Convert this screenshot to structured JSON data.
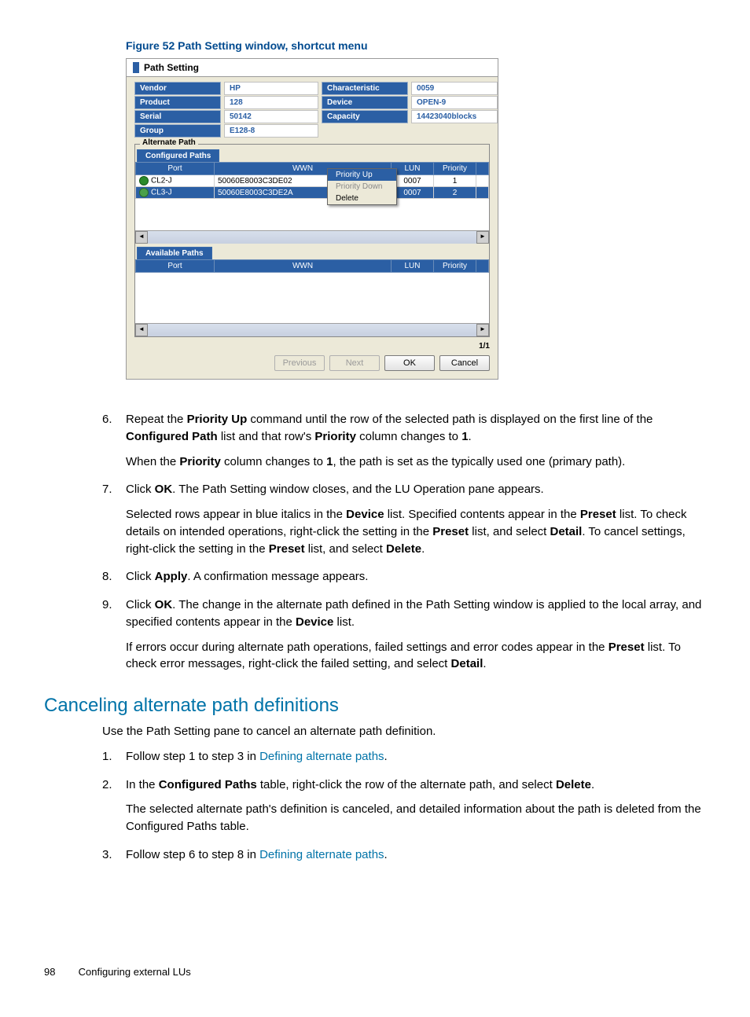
{
  "figure_caption": "Figure 52 Path Setting window, shortcut menu",
  "window": {
    "title": "Path Setting",
    "info": {
      "labels": {
        "vendor": "Vendor",
        "characteristic": "Characteristic",
        "product": "Product",
        "device": "Device",
        "serial": "Serial",
        "capacity": "Capacity",
        "group": "Group"
      },
      "values": {
        "vendor": "HP",
        "characteristic": "0059",
        "product": "128",
        "device": "OPEN-9",
        "serial": "50142",
        "capacity": "14423040blocks",
        "group": "E128-8"
      }
    },
    "alternate_path_label": "Alternate Path",
    "configured_tab": "Configured Paths",
    "available_tab": "Available Paths",
    "columns": {
      "port": "Port",
      "wwn": "WWN",
      "lun": "LUN",
      "priority": "Priority"
    },
    "configured_rows": [
      {
        "port": "CL2-J",
        "wwn": "50060E8003C3DE02",
        "lun": "0007",
        "priority": "1",
        "selected": false
      },
      {
        "port": "CL3-J",
        "wwn": "50060E8003C3DE2A",
        "lun": "0007",
        "priority": "2",
        "selected": true
      }
    ],
    "context_menu": {
      "priority_up": "Priority Up",
      "priority_down": "Priority Down",
      "delete": "Delete"
    },
    "page_indicator": "1/1",
    "buttons": {
      "previous": "Previous",
      "next": "Next",
      "ok": "OK",
      "cancel": "Cancel"
    }
  },
  "steps": {
    "s6a": "Repeat the ",
    "s6b": "Priority Up",
    "s6c": " command until the row of the selected path is displayed on the first line of the ",
    "s6d": "Configured Path",
    "s6e": " list and that row's ",
    "s6f": "Priority",
    "s6g": " column changes to ",
    "s6h": "1",
    "s6i": ".",
    "s6p2a": "When the ",
    "s6p2b": "Priority",
    "s6p2c": " column changes to ",
    "s6p2d": "1",
    "s6p2e": ", the path is set as the typically used one (primary path).",
    "s7a": "Click ",
    "s7b": "OK",
    "s7c": ". The Path Setting window closes, and the LU Operation pane appears.",
    "s7p2a": "Selected rows appear in blue italics in the ",
    "s7p2b": "Device",
    "s7p2c": " list. Specified contents appear in the ",
    "s7p2d": "Preset",
    "s7p2e": " list. To check details on intended operations, right-click the setting in the ",
    "s7p2f": "Preset",
    "s7p2g": " list, and select ",
    "s7p2h": "Detail",
    "s7p2i": ". To cancel settings, right-click the setting in the ",
    "s7p2j": "Preset",
    "s7p2k": " list, and select ",
    "s7p2l": "Delete",
    "s7p2m": ".",
    "s8a": "Click ",
    "s8b": "Apply",
    "s8c": ". A confirmation message appears.",
    "s9a": "Click ",
    "s9b": "OK",
    "s9c": ". The change in the alternate path defined in the Path Setting window is applied to the local array, and specified contents appear in the ",
    "s9d": "Device",
    "s9e": " list.",
    "s9p2a": "If errors occur during alternate path operations, failed settings and error codes appear in the ",
    "s9p2b": "Preset",
    "s9p2c": " list. To check error messages, right-click the failed setting, and select ",
    "s9p2d": "Detail",
    "s9p2e": "."
  },
  "section_heading": "Canceling alternate path definitions",
  "cancel_intro": "Use the Path Setting pane to cancel an alternate path definition.",
  "cancel": {
    "c1a": "Follow step 1 to step 3 in ",
    "c1link": "Defining alternate paths",
    "c1b": ".",
    "c2a": "In the ",
    "c2b": "Configured Paths",
    "c2c": " table, right-click the row of the alternate path, and select ",
    "c2d": "Delete",
    "c2e": ".",
    "c2p2": "The selected alternate path's definition is canceled, and detailed information about the path is deleted from the Configured Paths table.",
    "c3a": "Follow step 6 to step 8 in ",
    "c3link": "Defining alternate paths",
    "c3b": "."
  },
  "footer": {
    "page": "98",
    "title": "Configuring external LUs"
  },
  "nums": {
    "n6": "6.",
    "n7": "7.",
    "n8": "8.",
    "n9": "9.",
    "c1": "1.",
    "c2": "2.",
    "c3": "3."
  }
}
